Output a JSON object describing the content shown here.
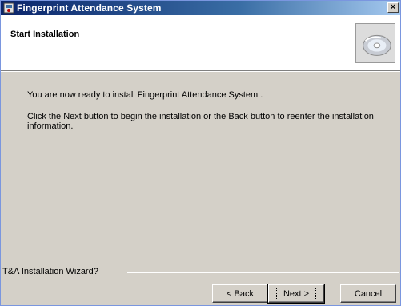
{
  "window": {
    "title": "Fingerprint Attendance System",
    "close_glyph": "×",
    "icon": "app-icon"
  },
  "header": {
    "title": "Start Installation",
    "icon": "cd-icon"
  },
  "body": {
    "line1": "You are now ready to install Fingerprint Attendance System .",
    "line2": "Click the Next button to begin the installation or the Back button to reenter the installation information."
  },
  "footer": {
    "wizard_label": "T&A Installation Wizard?",
    "back_label": "< Back",
    "next_label": "Next >",
    "cancel_label": "Cancel"
  },
  "colors": {
    "title_gradient_start": "#0a246a",
    "title_gradient_end": "#a6caf0",
    "dialog_bg": "#d4d0c8",
    "header_bg": "#ffffff"
  }
}
